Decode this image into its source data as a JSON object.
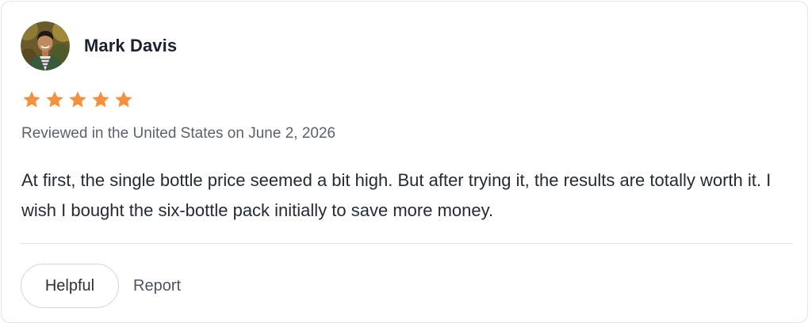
{
  "review": {
    "author": {
      "name": "Mark Davis",
      "avatar_icon": "user-avatar"
    },
    "rating": {
      "value": 5,
      "max": 5,
      "star_color": "#F5913E"
    },
    "date_text": "Reviewed in the United States on June 2, 2026",
    "body": "At first, the single bottle price seemed a bit high. But after trying it, the results are totally worth it. I wish I bought the six-bottle pack initially to save more money."
  },
  "actions": {
    "helpful_label": "Helpful",
    "report_label": "Report"
  }
}
